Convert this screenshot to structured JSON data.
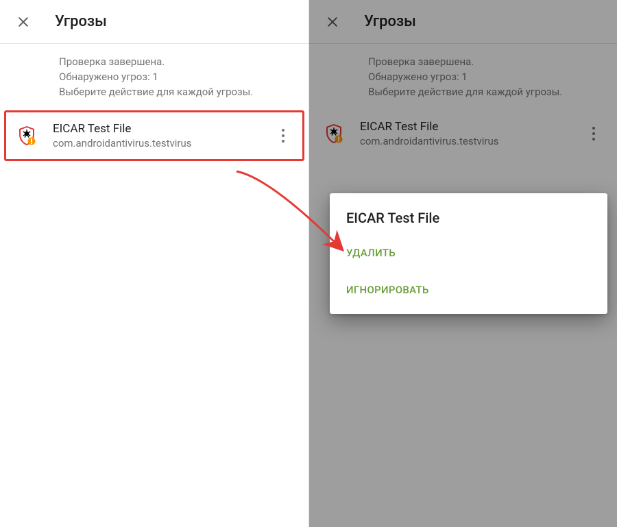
{
  "left": {
    "title": "Угрозы",
    "summary_line1": "Проверка завершена.",
    "summary_line2": "Обнаружено угроз: 1",
    "summary_line3": "Выберите действие для каждой угрозы.",
    "threat": {
      "name": "EICAR Test File",
      "package": "com.androidantivirus.testvirus"
    }
  },
  "right": {
    "title": "Угрозы",
    "summary_line1": "Проверка завершена.",
    "summary_line2": "Обнаружено угроз: 1",
    "summary_line3": "Выберите действие для каждой угрозы.",
    "threat": {
      "name": "EICAR Test File",
      "package": "com.androidantivirus.testvirus"
    },
    "popup": {
      "title": "EICAR Test File",
      "action_delete": "УДАЛИТЬ",
      "action_ignore": "ИГНОРИРОВАТЬ"
    }
  }
}
